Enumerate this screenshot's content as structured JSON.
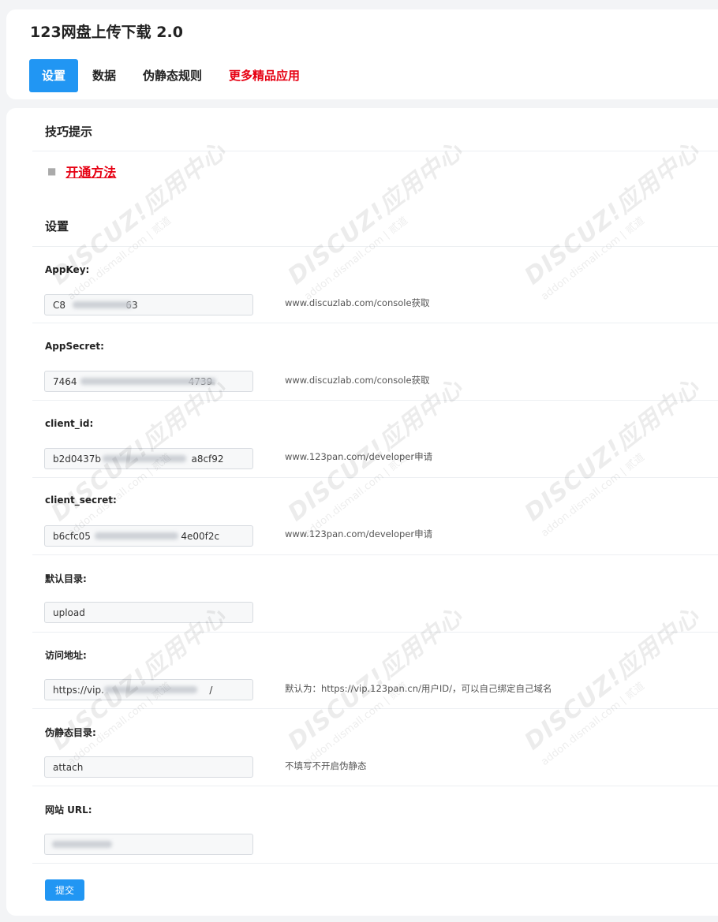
{
  "app": {
    "title": "123网盘上传下载 2.0"
  },
  "tabs": [
    {
      "label": "设置"
    },
    {
      "label": "数据"
    },
    {
      "label": "伪静态规则"
    },
    {
      "label": "更多精品应用"
    }
  ],
  "tips": {
    "title": "技巧提示",
    "link": "开通方法"
  },
  "settings": {
    "title": "设置",
    "fields": [
      {
        "label": "AppKey:",
        "value": "C8                    63",
        "hint": "www.discuzlab.com/console获取"
      },
      {
        "label": "AppSecret:",
        "value": "7464                                     4739",
        "hint": "www.discuzlab.com/console获取"
      },
      {
        "label": "client_id:",
        "value": "b2d0437b                              a8cf92",
        "hint": "www.123pan.com/developer申请"
      },
      {
        "label": "client_secret:",
        "value": "b6cfc05                              4e00f2c",
        "hint": "www.123pan.com/developer申请"
      },
      {
        "label": "默认目录:",
        "value": "upload",
        "hint": ""
      },
      {
        "label": "访问地址:",
        "value": "https://vip.                                   /",
        "hint": "默认为：https://vip.123pan.cn/用户ID/，可以自己绑定自己域名"
      },
      {
        "label": "伪静态目录:",
        "value": "attach",
        "hint": "不填写不开启伪静态"
      },
      {
        "label": "网站 URL:",
        "value": "",
        "hint": ""
      }
    ],
    "submit": "提交"
  },
  "watermark": {
    "text": "DISCUZ!应用中心",
    "domain": "addon.dismall.com",
    "brand": "贰道"
  },
  "colors": {
    "accent": "#2196f3",
    "link_red": "#e60012"
  }
}
